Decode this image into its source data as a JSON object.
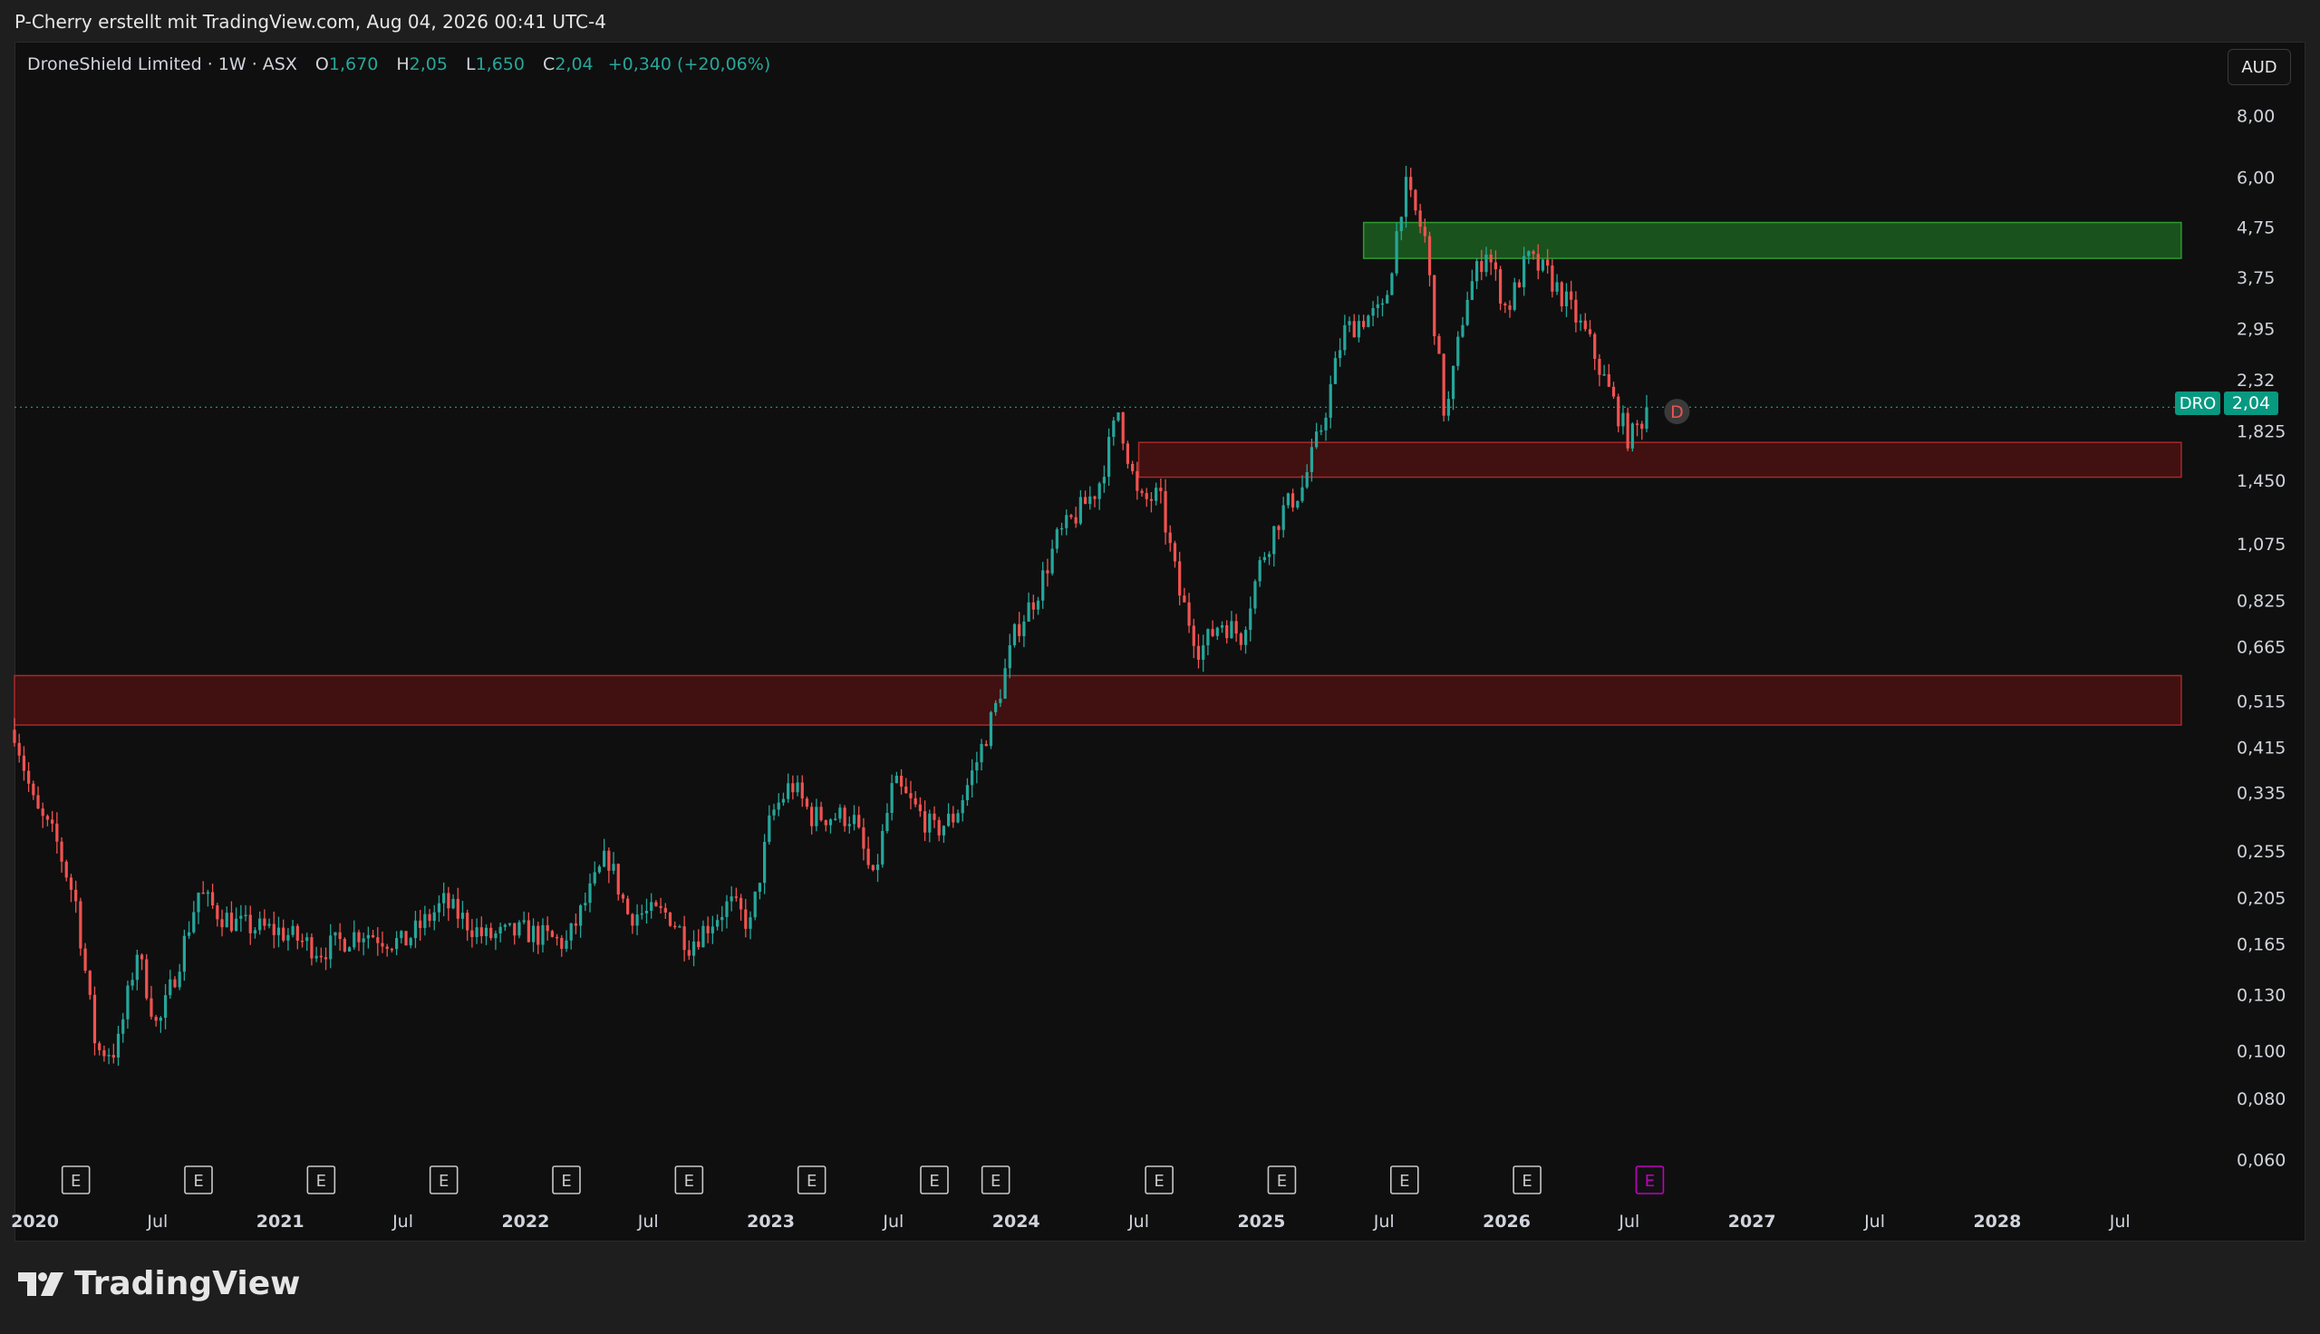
{
  "header": {
    "text": "P-Cherry erstellt mit TradingView.com, Aug 04, 2026 00:41 UTC-4"
  },
  "legend": {
    "symbol": "DroneShield Limited · 1W · ASX",
    "o_label": "O",
    "o_value": "1,670",
    "h_label": "H",
    "h_value": "2,05",
    "l_label": "L",
    "l_value": "1,650",
    "c_label": "C",
    "c_value": "2,04",
    "change": "+0,340 (+20,06%)"
  },
  "currency": "AUD",
  "price_tag": {
    "symbol": "DRO",
    "value": "2,04"
  },
  "earnings_marker": "E",
  "dividend_marker": "D",
  "brand": {
    "name": "TradingView"
  },
  "colors": {
    "up": "#26a69a",
    "down": "#ef5350",
    "background": "#0f0f0f",
    "resistance_zone": "#1b5e20",
    "support_zone": "#4a1111",
    "upcoming_earnings": "#c000c0"
  },
  "chart_data": {
    "type": "candlestick",
    "title": "DroneShield Limited · 1W · ASX",
    "y_scale": "log",
    "ylim": [
      0.055,
      9.0
    ],
    "y_ticks": [
      {
        "value": 8.0,
        "label": "8,00"
      },
      {
        "value": 6.0,
        "label": "6,00"
      },
      {
        "value": 4.75,
        "label": "4,75"
      },
      {
        "value": 3.75,
        "label": "3,75"
      },
      {
        "value": 2.95,
        "label": "2,95"
      },
      {
        "value": 2.32,
        "label": "2,32"
      },
      {
        "value": 1.825,
        "label": "1,825"
      },
      {
        "value": 1.45,
        "label": "1,450"
      },
      {
        "value": 1.075,
        "label": "1,075"
      },
      {
        "value": 0.825,
        "label": "0,825"
      },
      {
        "value": 0.665,
        "label": "0,665"
      },
      {
        "value": 0.515,
        "label": "0,515"
      },
      {
        "value": 0.415,
        "label": "0,415"
      },
      {
        "value": 0.335,
        "label": "0,335"
      },
      {
        "value": 0.255,
        "label": "0,255"
      },
      {
        "value": 0.205,
        "label": "0,205"
      },
      {
        "value": 0.165,
        "label": "0,165"
      },
      {
        "value": 0.13,
        "label": "0,130"
      },
      {
        "value": 0.1,
        "label": "0,100"
      },
      {
        "value": 0.08,
        "label": "0,080"
      },
      {
        "value": 0.06,
        "label": "0,060"
      }
    ],
    "x_range": [
      "2019-12",
      "2028-12"
    ],
    "x_ticks": [
      {
        "date": "2020-01",
        "label": "2020",
        "bold": true
      },
      {
        "date": "2020-07",
        "label": "Jul",
        "bold": false
      },
      {
        "date": "2021-01",
        "label": "2021",
        "bold": true
      },
      {
        "date": "2021-07",
        "label": "Jul",
        "bold": false
      },
      {
        "date": "2022-01",
        "label": "2022",
        "bold": true
      },
      {
        "date": "2022-07",
        "label": "Jul",
        "bold": false
      },
      {
        "date": "2023-01",
        "label": "2023",
        "bold": true
      },
      {
        "date": "2023-07",
        "label": "Jul",
        "bold": false
      },
      {
        "date": "2024-01",
        "label": "2024",
        "bold": true
      },
      {
        "date": "2024-07",
        "label": "Jul",
        "bold": false
      },
      {
        "date": "2025-01",
        "label": "2025",
        "bold": true
      },
      {
        "date": "2025-07",
        "label": "Jul",
        "bold": false
      },
      {
        "date": "2026-01",
        "label": "2026",
        "bold": true
      },
      {
        "date": "2026-07",
        "label": "Jul",
        "bold": false
      },
      {
        "date": "2027-01",
        "label": "2027",
        "bold": true
      },
      {
        "date": "2027-07",
        "label": "Jul",
        "bold": false
      },
      {
        "date": "2028-01",
        "label": "2028",
        "bold": true
      },
      {
        "date": "2028-07",
        "label": "Jul",
        "bold": false
      }
    ],
    "last_price": 2.04,
    "zones": [
      {
        "name": "resistance",
        "from": "2025-06",
        "to": "2028-10",
        "low": 4.1,
        "high": 4.85
      },
      {
        "name": "support-upper",
        "from": "2024-07",
        "to": "2028-10",
        "low": 1.47,
        "high": 1.73
      },
      {
        "name": "support-lower",
        "from": "2019-12",
        "to": "2028-10",
        "low": 0.46,
        "high": 0.58
      }
    ],
    "earnings": [
      {
        "date": "2020-03",
        "upcoming": false
      },
      {
        "date": "2020-09",
        "upcoming": false
      },
      {
        "date": "2021-03",
        "upcoming": false
      },
      {
        "date": "2021-09",
        "upcoming": false
      },
      {
        "date": "2022-03",
        "upcoming": false
      },
      {
        "date": "2022-09",
        "upcoming": false
      },
      {
        "date": "2023-03",
        "upcoming": false
      },
      {
        "date": "2023-09",
        "upcoming": false
      },
      {
        "date": "2023-12",
        "upcoming": false
      },
      {
        "date": "2024-08",
        "upcoming": false
      },
      {
        "date": "2025-02",
        "upcoming": false
      },
      {
        "date": "2025-08",
        "upcoming": false
      },
      {
        "date": "2026-02",
        "upcoming": false
      },
      {
        "date": "2026-08",
        "upcoming": true
      }
    ],
    "dividend": {
      "date": "2026-08",
      "value": 2.0
    },
    "path": [
      [
        "2019-12",
        0.45
      ],
      [
        "2020-01",
        0.31
      ],
      [
        "2020-02",
        0.27
      ],
      [
        "2020-03",
        0.2
      ],
      [
        "2020-04",
        0.1
      ],
      [
        "2020-05",
        0.1
      ],
      [
        "2020-06",
        0.16
      ],
      [
        "2020-07",
        0.11
      ],
      [
        "2020-08",
        0.15
      ],
      [
        "2020-09",
        0.21
      ],
      [
        "2020-10",
        0.19
      ],
      [
        "2020-11",
        0.18
      ],
      [
        "2021-01",
        0.175
      ],
      [
        "2021-03",
        0.16
      ],
      [
        "2021-05",
        0.175
      ],
      [
        "2021-07",
        0.165
      ],
      [
        "2021-09",
        0.2
      ],
      [
        "2021-11",
        0.17
      ],
      [
        "2022-01",
        0.175
      ],
      [
        "2022-03",
        0.165
      ],
      [
        "2022-05",
        0.25
      ],
      [
        "2022-06",
        0.19
      ],
      [
        "2022-08",
        0.19
      ],
      [
        "2022-09",
        0.165
      ],
      [
        "2022-11",
        0.2
      ],
      [
        "2022-12",
        0.18
      ],
      [
        "2023-01",
        0.3
      ],
      [
        "2023-02",
        0.35
      ],
      [
        "2023-03",
        0.3
      ],
      [
        "2023-05",
        0.3
      ],
      [
        "2023-06",
        0.22
      ],
      [
        "2023-07",
        0.35
      ],
      [
        "2023-09",
        0.28
      ],
      [
        "2023-10",
        0.3
      ],
      [
        "2023-11",
        0.38
      ],
      [
        "2023-12",
        0.5
      ],
      [
        "2024-01",
        0.72
      ],
      [
        "2024-02",
        0.85
      ],
      [
        "2024-03",
        1.1
      ],
      [
        "2024-05",
        1.4
      ],
      [
        "2024-06",
        2.0
      ],
      [
        "2024-07",
        1.3
      ],
      [
        "2024-08",
        1.35
      ],
      [
        "2024-09",
        0.85
      ],
      [
        "2024-10",
        0.65
      ],
      [
        "2024-11",
        0.75
      ],
      [
        "2024-12",
        0.7
      ],
      [
        "2025-01",
        1.0
      ],
      [
        "2025-02",
        1.25
      ],
      [
        "2025-03",
        1.4
      ],
      [
        "2025-04",
        1.9
      ],
      [
        "2025-05",
        2.9
      ],
      [
        "2025-06",
        3.1
      ],
      [
        "2025-07",
        3.2
      ],
      [
        "2025-08",
        5.8
      ],
      [
        "2025-09",
        4.5
      ],
      [
        "2025-10",
        1.9
      ],
      [
        "2025-11",
        3.4
      ],
      [
        "2025-12",
        4.3
      ],
      [
        "2026-01",
        3.2
      ],
      [
        "2026-02",
        4.1
      ],
      [
        "2026-03",
        3.8
      ],
      [
        "2026-04",
        3.3
      ],
      [
        "2026-05",
        2.8
      ],
      [
        "2026-06",
        2.2
      ],
      [
        "2026-07",
        1.75
      ],
      [
        "2026-08",
        2.04
      ]
    ]
  }
}
